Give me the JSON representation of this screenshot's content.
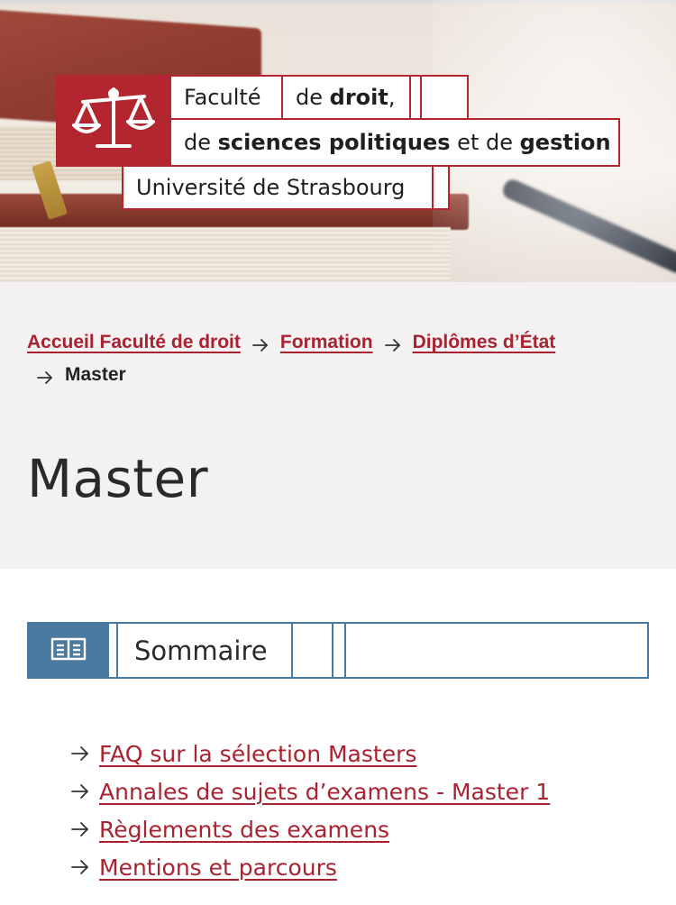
{
  "logo": {
    "line1_word1": "Faculté",
    "line1_prefix": "de ",
    "line1_bold": "droit",
    "line1_suffix": ",",
    "line2_prefix": "de ",
    "line2_bold1": "sciences politiques",
    "line2_mid": " et de ",
    "line2_bold2": "gestion",
    "line3": "Université de Strasbourg",
    "icon": "scales-of-justice-icon"
  },
  "breadcrumb": {
    "items": [
      {
        "label": "Accueil Faculté de droit"
      },
      {
        "label": "Formation"
      },
      {
        "label": "Diplômes d’État"
      }
    ],
    "current": "Master"
  },
  "page": {
    "title": "Master"
  },
  "summary": {
    "label": "Sommaire",
    "icon": "open-book-icon",
    "links": [
      {
        "label": "FAQ sur la sélection Masters"
      },
      {
        "label": "Annales de sujets d’examens - Master 1"
      },
      {
        "label": "Règlements des examens"
      },
      {
        "label": "Mentions et parcours"
      }
    ]
  },
  "colors": {
    "brand_red": "#b3262f",
    "link_red": "#a8232f",
    "summary_blue": "#4a7aa0",
    "crumb_bg": "#f3f1f2"
  }
}
